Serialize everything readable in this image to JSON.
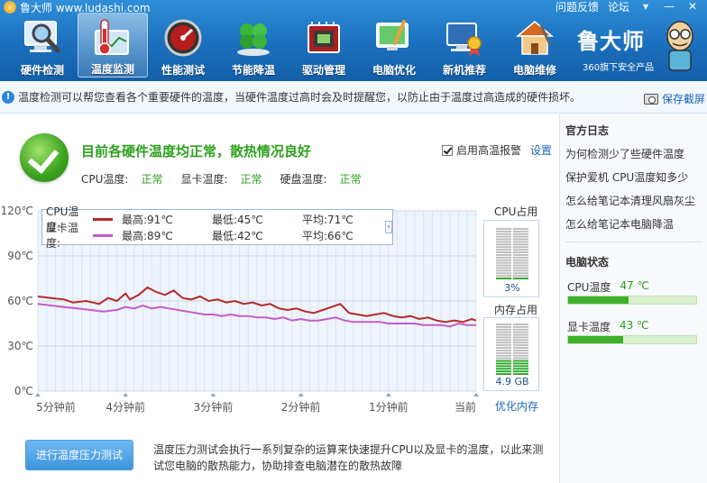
{
  "app": {
    "title": "鲁大师 www.ludashi.com",
    "top_links": [
      "问题反馈",
      "论坛"
    ],
    "win_controls": [
      "▾",
      "—",
      "✕"
    ]
  },
  "toolbar": {
    "items": [
      {
        "label": "硬件检测",
        "icon": "magnifier-monitor-icon",
        "active": false
      },
      {
        "label": "温度监测",
        "icon": "thermometer-icon",
        "active": true
      },
      {
        "label": "性能测试",
        "icon": "speedometer-icon",
        "active": false
      },
      {
        "label": "节能降温",
        "icon": "clover-leaf-icon",
        "active": false
      },
      {
        "label": "驱动管理",
        "icon": "chip-icon",
        "active": false
      },
      {
        "label": "电脑优化",
        "icon": "clean-screen-icon",
        "active": false
      },
      {
        "label": "新机推荐",
        "icon": "award-computer-icon",
        "active": false
      },
      {
        "label": "电脑维修",
        "icon": "repair-house-icon",
        "active": false
      }
    ]
  },
  "brand": {
    "name": "鲁大师",
    "subtitle": "360旗下安全产品"
  },
  "notice": {
    "text": "温度检测可以帮您查看各个重要硬件的温度，当硬件温度过高时会及时提醒您，以防止由于温度过高造成的硬件损坏。",
    "save_label": "保存截屏"
  },
  "status": {
    "title": "目前各硬件温度均正常，散热情况良好",
    "items": [
      {
        "label": "CPU温度:",
        "value": "正常"
      },
      {
        "label": "显卡温度:",
        "value": "正常"
      },
      {
        "label": "硬盘温度:",
        "value": "正常"
      }
    ],
    "alarm_label": "启用高温报警",
    "settings_label": "设置"
  },
  "legend": {
    "rows": [
      {
        "name": "CPU温度:",
        "max": "最高:91℃",
        "min": "最低:45℃",
        "avg": "平均:71℃",
        "color": "#b52a2a"
      },
      {
        "name": "显卡温度:",
        "max": "最高:89℃",
        "min": "最低:42℃",
        "avg": "平均:66℃",
        "color": "#c45cc8"
      }
    ],
    "collapse": "‹"
  },
  "chart_data": {
    "type": "line",
    "y_ticks": [
      "120℃",
      "90℃",
      "60℃",
      "30℃",
      "0℃"
    ],
    "ylim": [
      0,
      120
    ],
    "x_ticks": [
      "5分钟前",
      "4分钟前",
      "3分钟前",
      "2分钟前",
      "1分钟前",
      "当前"
    ],
    "x_minutes_ago": [
      5,
      4,
      3,
      2,
      1,
      0
    ],
    "xlim": [
      5,
      0
    ],
    "series": [
      {
        "name": "CPU温度",
        "color": "#b52a2a",
        "x": [
          5,
          4.85,
          4.7,
          4.6,
          4.45,
          4.3,
          4.2,
          4.1,
          4.0,
          3.95,
          3.85,
          3.75,
          3.65,
          3.55,
          3.45,
          3.35,
          3.25,
          3.15,
          3.05,
          2.95,
          2.85,
          2.75,
          2.65,
          2.55,
          2.45,
          2.35,
          2.25,
          2.15,
          2.05,
          1.95,
          1.85,
          1.75,
          1.65,
          1.55,
          1.45,
          1.35,
          1.25,
          1.15,
          1.05,
          0.95,
          0.85,
          0.75,
          0.65,
          0.55,
          0.45,
          0.35,
          0.25,
          0.15,
          0.05,
          0
        ],
        "y": [
          63,
          62,
          61,
          59,
          60,
          58,
          62,
          60,
          65,
          61,
          64,
          69,
          66,
          64,
          67,
          62,
          61,
          63,
          60,
          61,
          59,
          60,
          58,
          59,
          57,
          58,
          55,
          54,
          55,
          53,
          52,
          54,
          56,
          58,
          52,
          51,
          50,
          51,
          52,
          50,
          49,
          50,
          48,
          49,
          47,
          46,
          47,
          46,
          48,
          47
        ]
      },
      {
        "name": "显卡温度",
        "color": "#c45cc8",
        "x": [
          5,
          4.85,
          4.7,
          4.55,
          4.4,
          4.25,
          4.1,
          4.0,
          3.9,
          3.8,
          3.7,
          3.6,
          3.5,
          3.4,
          3.3,
          3.2,
          3.1,
          3.0,
          2.9,
          2.8,
          2.7,
          2.6,
          2.5,
          2.4,
          2.3,
          2.2,
          2.1,
          2.0,
          1.9,
          1.8,
          1.7,
          1.6,
          1.5,
          1.4,
          1.3,
          1.2,
          1.1,
          1.0,
          0.9,
          0.8,
          0.7,
          0.6,
          0.5,
          0.4,
          0.3,
          0.2,
          0.1,
          0
        ],
        "y": [
          58,
          57,
          56,
          55,
          54,
          53,
          54,
          56,
          55,
          57,
          55,
          56,
          55,
          54,
          53,
          52,
          51,
          51,
          50,
          51,
          50,
          50,
          49,
          49,
          48,
          49,
          47,
          48,
          47,
          47,
          48,
          49,
          47,
          46,
          46,
          46,
          46,
          45,
          45,
          45,
          45,
          44,
          44,
          44,
          43,
          45,
          44,
          44
        ]
      }
    ],
    "grid": true
  },
  "meters": {
    "cpu": {
      "title": "CPU占用",
      "value_label": "3%",
      "fraction": 0.03,
      "color": "#2aa82a"
    },
    "mem": {
      "title": "内存占用",
      "value_label": "4.9 GB",
      "fraction": 0.3,
      "color": "#2aa82a"
    },
    "optimize_label": "优化内存"
  },
  "bottom": {
    "button_label": "进行温度压力测试",
    "description": "温度压力测试会执行一系列复杂的运算来快速提升CPU以及显卡的温度，以此来测试您电脑的散热能力，协助排查电脑潜在的散热故障"
  },
  "right_panel": {
    "log_title": "官方日志",
    "links": [
      "为何检测少了些硬件温度",
      "保护爱机 CPU温度知多少",
      "怎么给笔记本清理风扇灰尘",
      "怎么给笔记本电脑降温"
    ],
    "state_title": "电脑状态",
    "temps": [
      {
        "label": "CPU温度",
        "value": "47 ℃",
        "fraction": 0.47
      },
      {
        "label": "显卡温度",
        "value": "43 ℃",
        "fraction": 0.43
      }
    ]
  }
}
